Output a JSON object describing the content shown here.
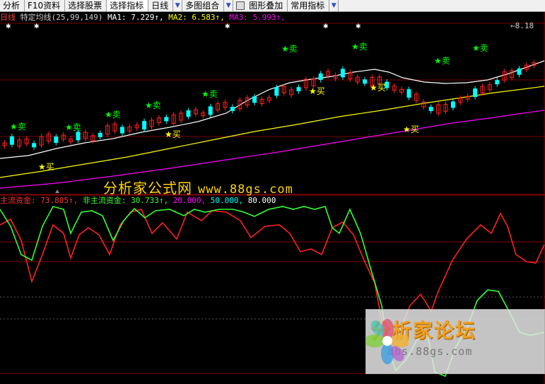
{
  "toolbar": {
    "items": [
      {
        "label": "分析",
        "arrow": false
      },
      {
        "label": "F10资料",
        "arrow": false
      },
      {
        "label": "选择股票",
        "arrow": false
      },
      {
        "label": "选择指标",
        "arrow": false,
        "active": true
      },
      {
        "label": "日线",
        "arrow": true
      },
      {
        "label": "多图组合",
        "arrow": true
      },
      {
        "label": "图形叠加",
        "arrow": false
      },
      {
        "label": "常用指标",
        "arrow": true
      }
    ]
  },
  "main_panel": {
    "period": "日线",
    "indicator": "特定均线(25,99,149)",
    "ma1_label": "MA1: 7.229↑,",
    "ma2_label": "MA2: 6.583↑,",
    "ma3_label": "MA3: 5.993↑,",
    "high_label": "8.18",
    "sell_text": "卖",
    "buy_text": "买",
    "colors": {
      "ma1": "#ffffff",
      "ma2": "#ffff00",
      "ma3": "#ff00ff",
      "up": "#ff2020",
      "down": "#00ffff",
      "sell": "#00ff00",
      "buy": "#ffff00"
    }
  },
  "brand": {
    "name": "分析家公式网",
    "url": "www.88gs.com"
  },
  "sub_panel": {
    "main_fund_label": "主流资金: 73.805↑,",
    "non_main_fund_label": "非主流资金: 30.733↑,",
    "level1": "20.000,",
    "level2": "50.000,",
    "level3": "80.000",
    "colors": {
      "main": "#ff2020",
      "nonmain": "#33ff33",
      "level1": "#ff00ff",
      "level2": "#00ffff",
      "level3": "#ffffff"
    }
  },
  "watermark": {
    "title": "分析家论坛",
    "url": "bbs.88gs.com"
  },
  "chart_data": [
    {
      "type": "candlestick",
      "title": "特定均线(25,99,149)",
      "series": [
        {
          "name": "MA1",
          "value_at_last": 7.229
        },
        {
          "name": "MA2",
          "value_at_last": 6.583
        },
        {
          "name": "MA3",
          "value_at_last": 5.993
        }
      ],
      "annotations": [
        "卖",
        "买",
        "8.18"
      ],
      "grid": true
    },
    {
      "type": "line",
      "series": [
        {
          "name": "主流资金",
          "value_at_last": 73.805
        },
        {
          "name": "非主流资金",
          "value_at_last": 30.733
        }
      ],
      "reference_lines": [
        20,
        50,
        80
      ],
      "grid": true
    }
  ]
}
